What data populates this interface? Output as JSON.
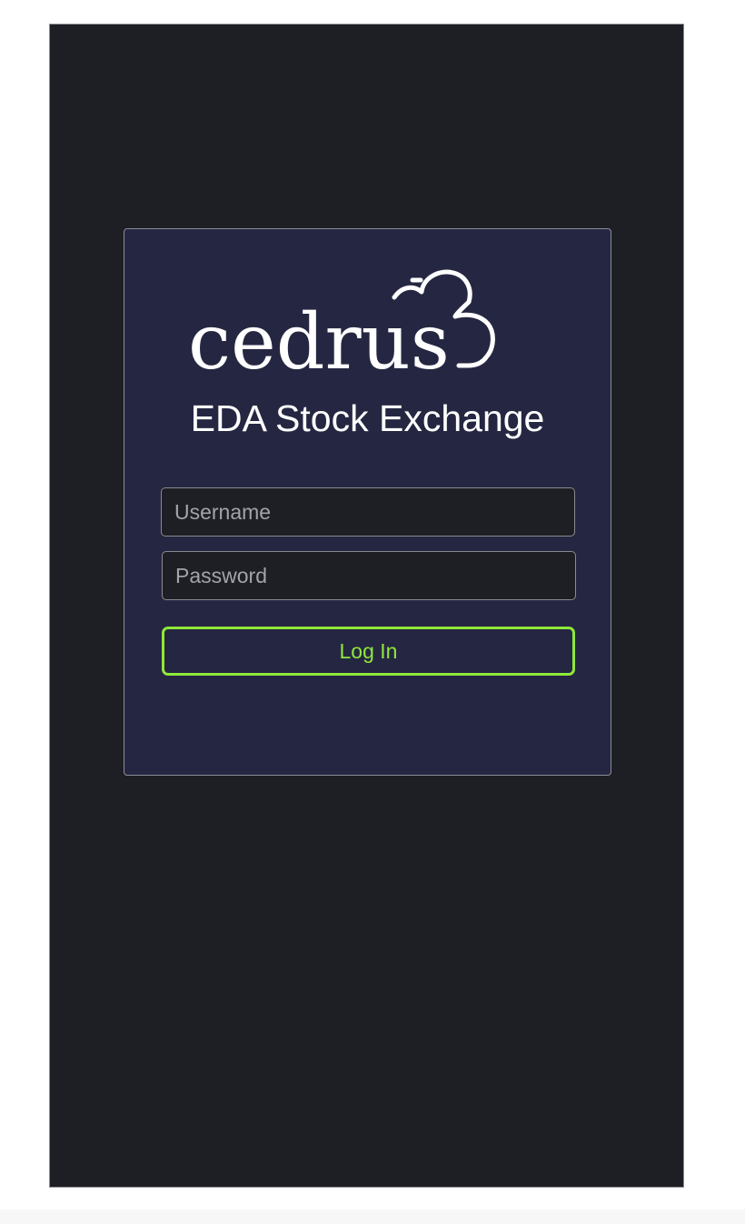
{
  "logo": {
    "wordmark": "cedrus",
    "icon": "cloud-icon"
  },
  "app": {
    "title": "EDA Stock Exchange"
  },
  "form": {
    "username": {
      "value": "",
      "placeholder": "Username"
    },
    "password": {
      "value": "",
      "placeholder": "Password"
    },
    "login_label": "Log In"
  },
  "colors": {
    "screen_background": "#1e1e25",
    "card_background": "#252742",
    "accent": "#8fe83a",
    "text": "#ffffff"
  }
}
